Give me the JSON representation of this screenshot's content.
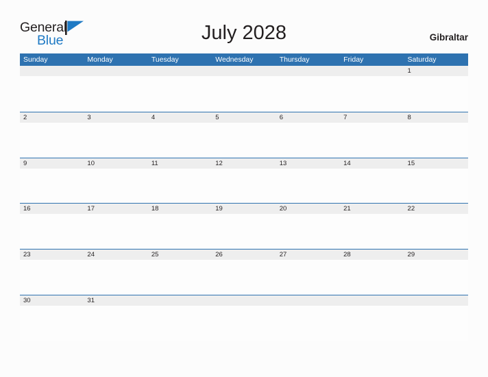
{
  "brand": {
    "word_one": "General",
    "word_two": "Blue",
    "flag_icon": "triangle-flag-icon",
    "color_dark": "#231f20",
    "color_blue": "#1f7ac4"
  },
  "header": {
    "title": "July 2028",
    "country": "Gibraltar"
  },
  "calendar": {
    "accent_color": "#2e72b0",
    "band_color": "#eeeeee",
    "day_names": [
      "Sunday",
      "Monday",
      "Tuesday",
      "Wednesday",
      "Thursday",
      "Friday",
      "Saturday"
    ],
    "weeks": [
      [
        "",
        "",
        "",
        "",
        "",
        "",
        "1"
      ],
      [
        "2",
        "3",
        "4",
        "5",
        "6",
        "7",
        "8"
      ],
      [
        "9",
        "10",
        "11",
        "12",
        "13",
        "14",
        "15"
      ],
      [
        "16",
        "17",
        "18",
        "19",
        "20",
        "21",
        "22"
      ],
      [
        "23",
        "24",
        "25",
        "26",
        "27",
        "28",
        "29"
      ],
      [
        "30",
        "31",
        "",
        "",
        "",
        "",
        ""
      ]
    ]
  }
}
